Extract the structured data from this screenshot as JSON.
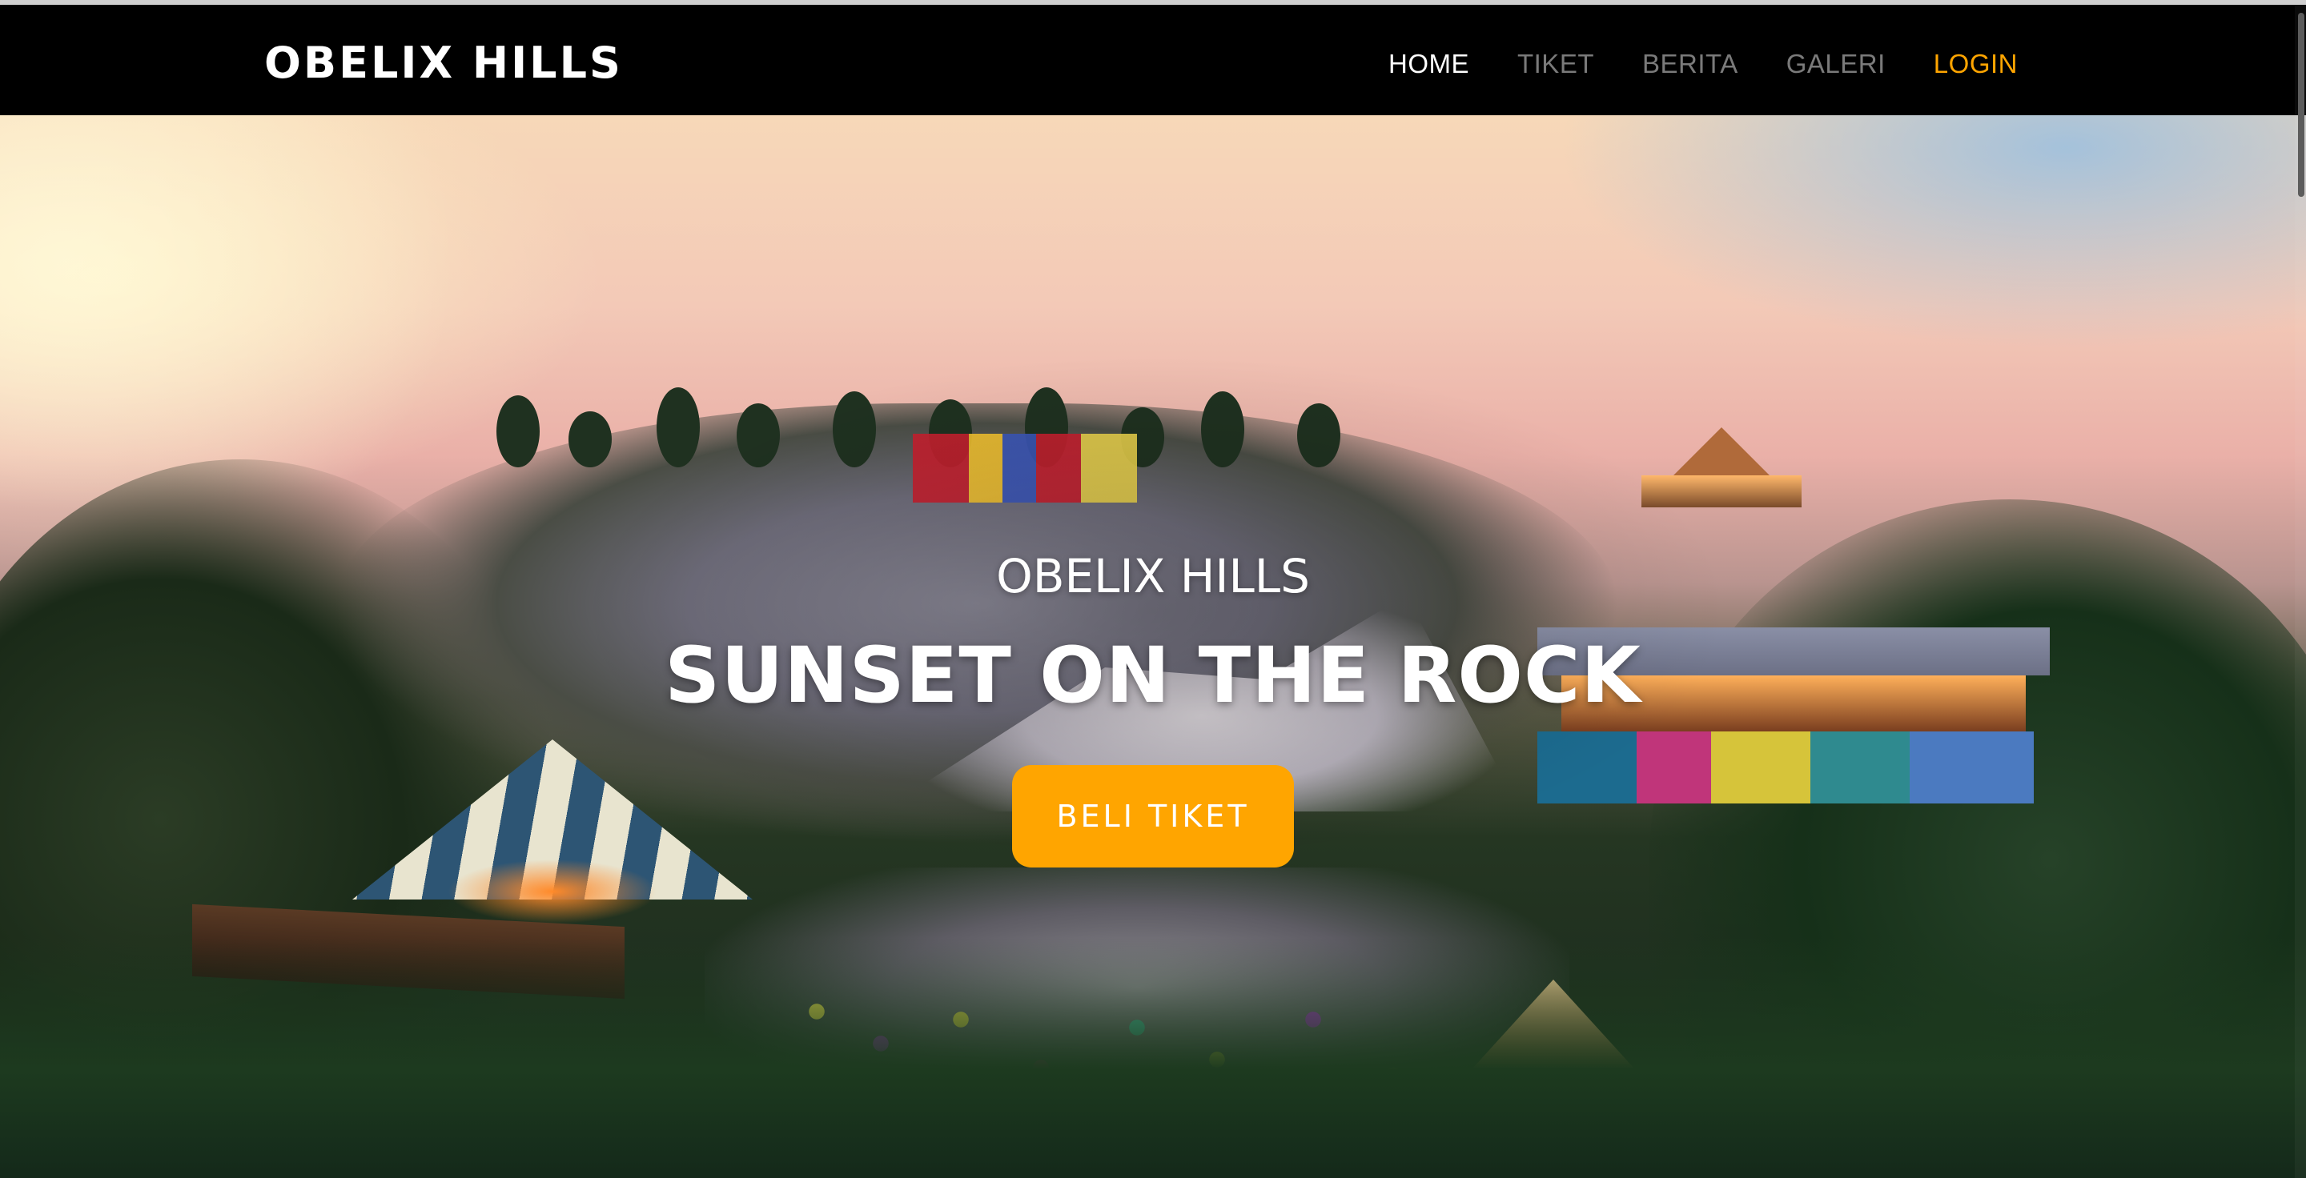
{
  "navbar": {
    "brand": "OBELIX HILLS",
    "links": [
      {
        "label": "HOME",
        "state": "active"
      },
      {
        "label": "TIKET",
        "state": "normal"
      },
      {
        "label": "BERITA",
        "state": "normal"
      },
      {
        "label": "GALERI",
        "state": "normal"
      },
      {
        "label": "LOGIN",
        "state": "highlight"
      }
    ]
  },
  "hero": {
    "subtitle": "OBELIX HILLS",
    "title": "SUNSET ON THE ROCK",
    "cta_label": "BELI TIKET"
  },
  "colors": {
    "accent": "#ffa500",
    "navbar_bg": "#000000",
    "nav_inactive": "#7a7a7a",
    "nav_active": "#ffffff"
  }
}
